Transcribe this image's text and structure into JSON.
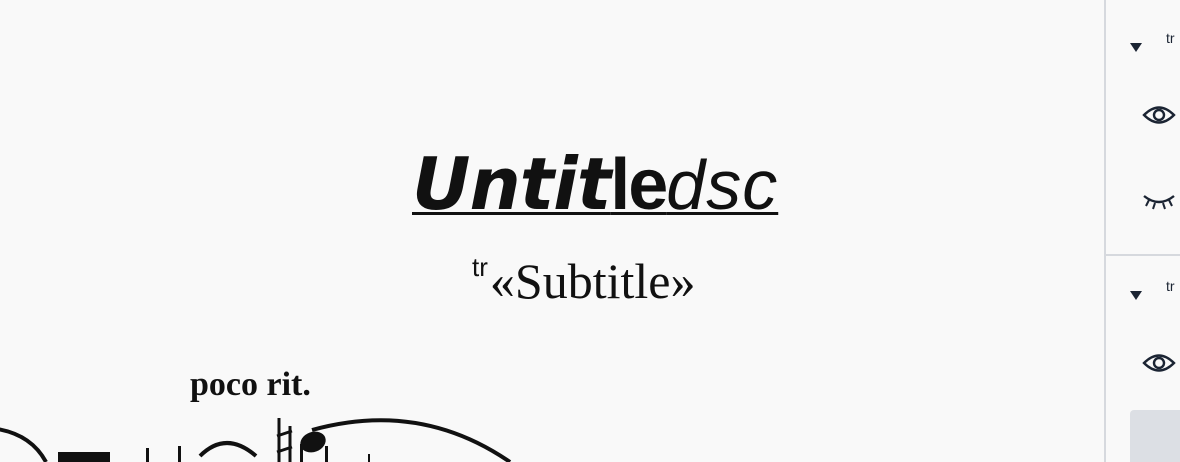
{
  "score": {
    "title": {
      "part1": "Untit",
      "part2": "le",
      "part3": "dsc"
    },
    "subtitle": {
      "prefix": "tr",
      "text": "«Subtitle»"
    },
    "tempo_marking": "poco rit."
  },
  "panel": {
    "section1": {
      "label": "tr"
    },
    "section2": {
      "label": "tr"
    }
  },
  "icons": {
    "caret": "triangle-down",
    "visible": "eye-open",
    "hidden": "eye-closed"
  }
}
